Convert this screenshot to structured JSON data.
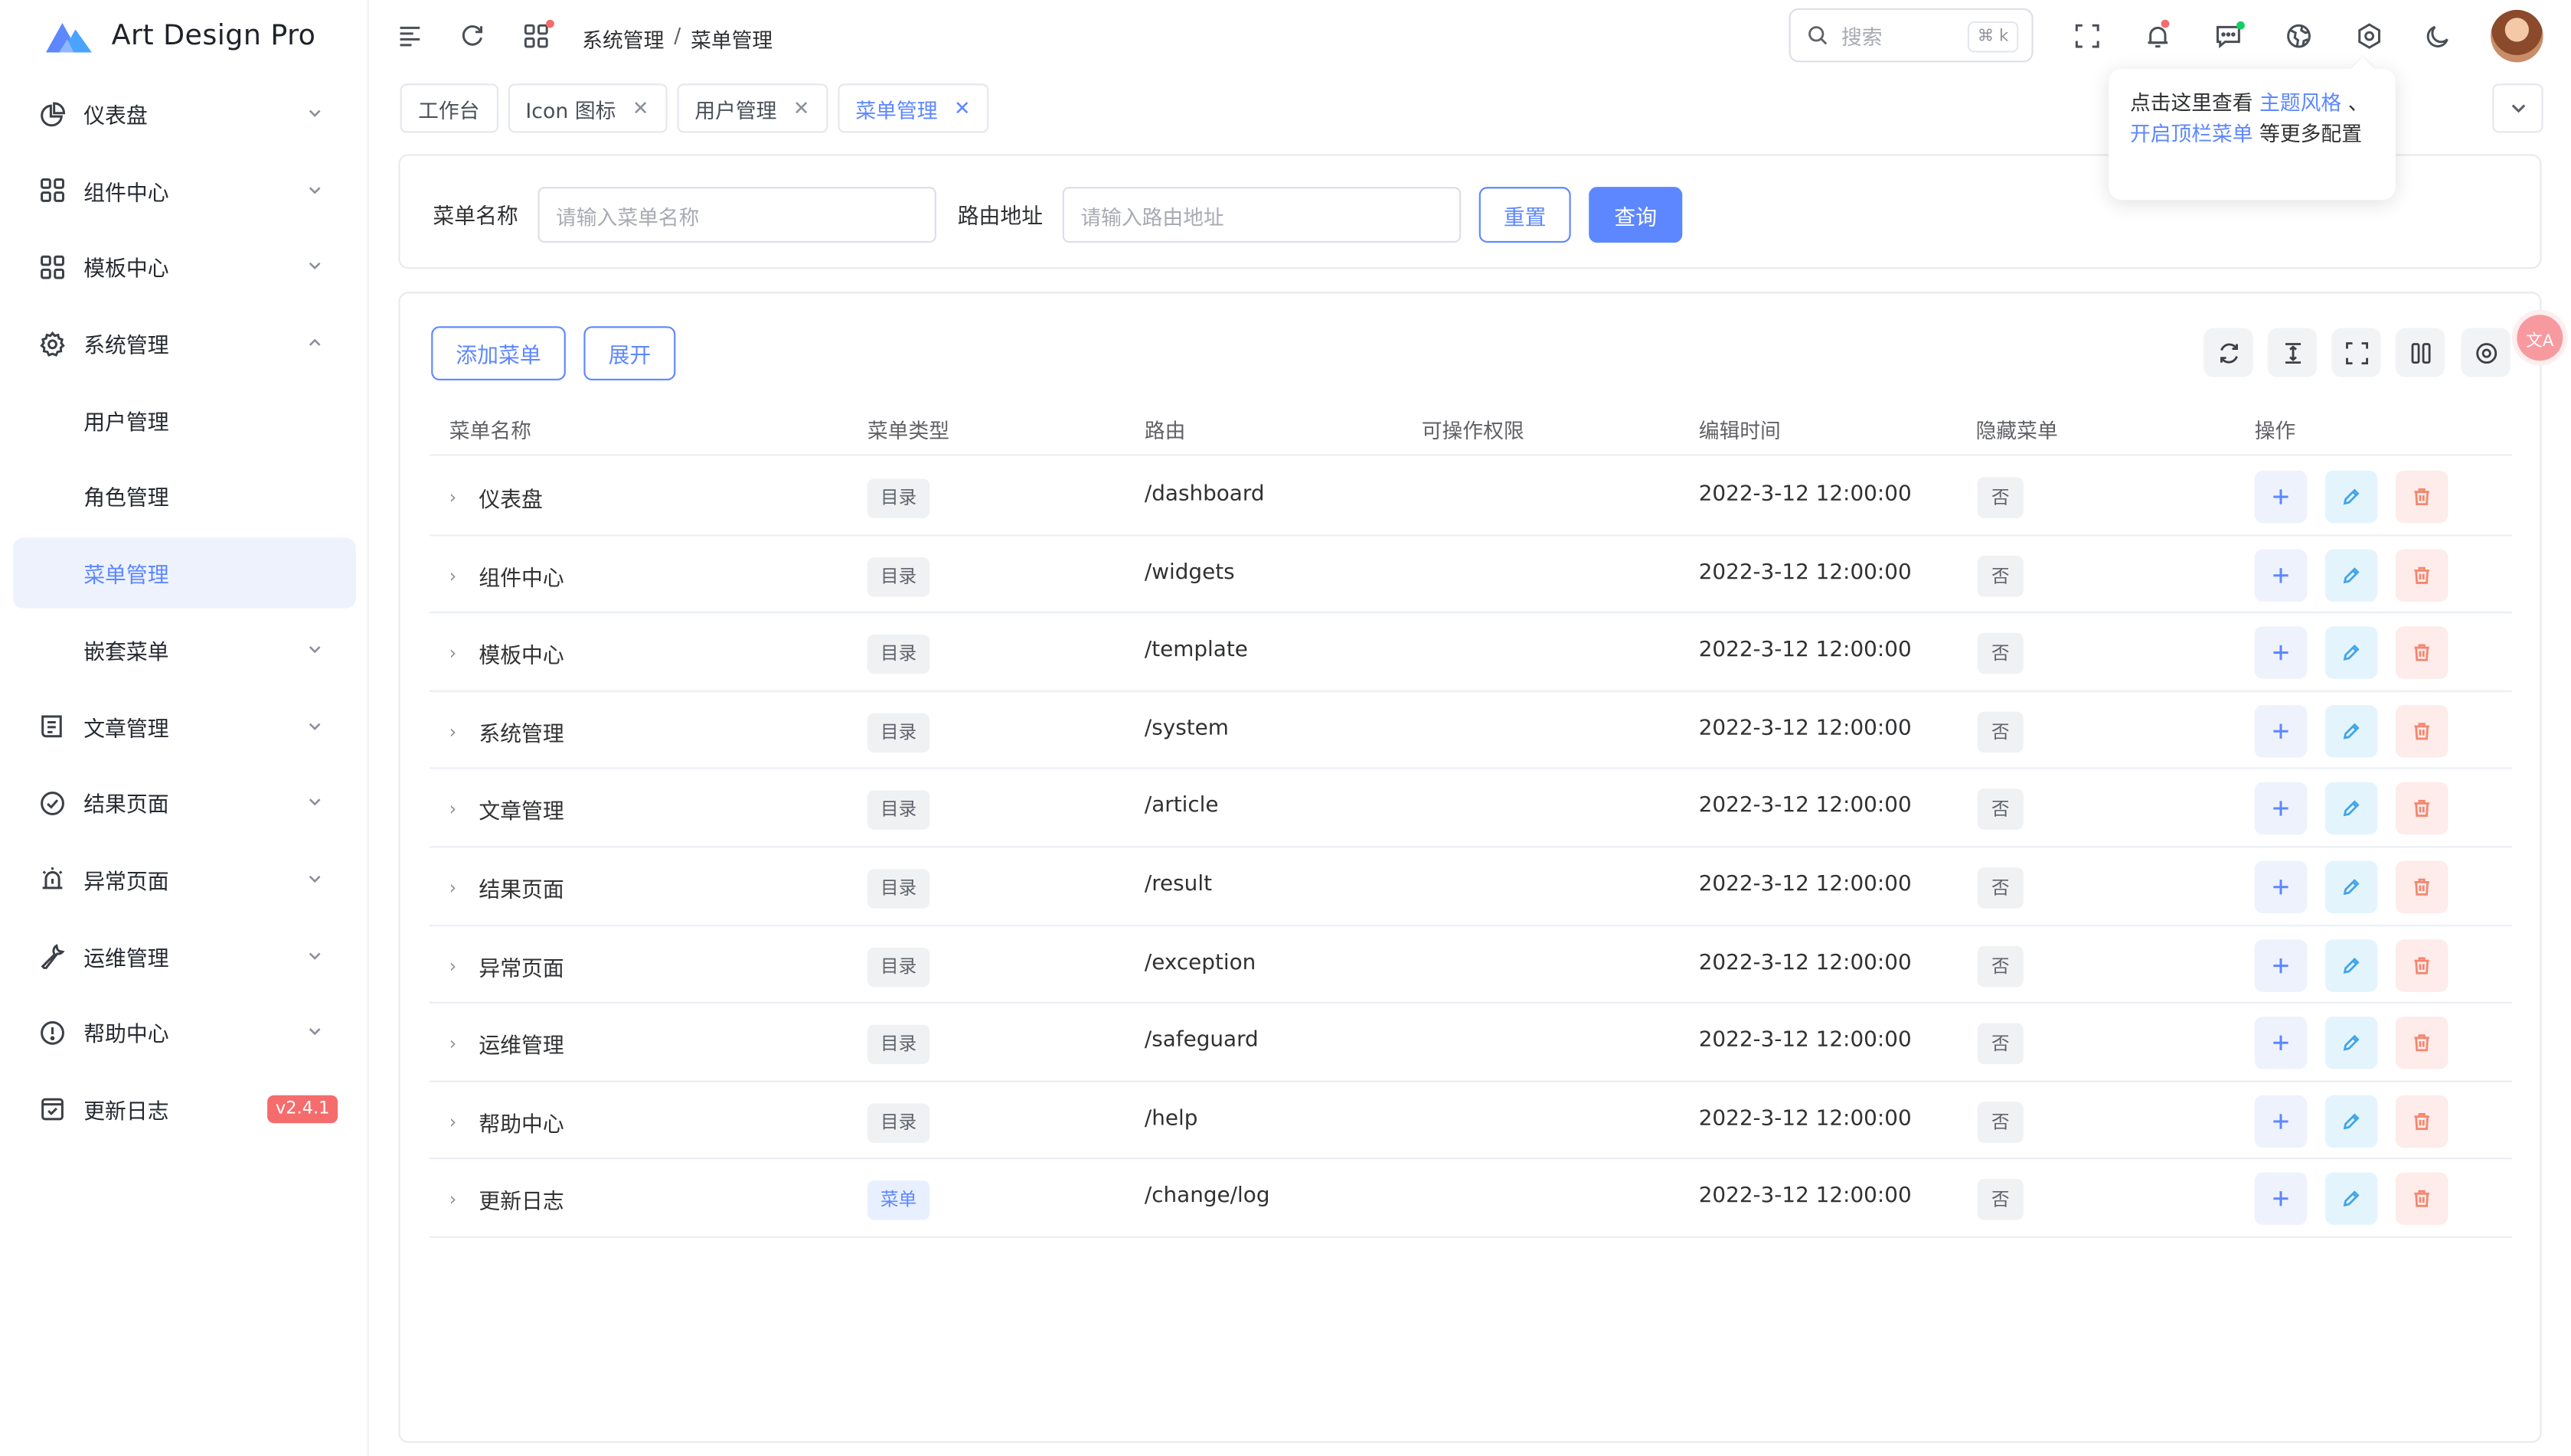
{
  "app": {
    "title": "Art Design Pro"
  },
  "colors": {
    "primary": "#5d87ff",
    "danger": "#f56c6c",
    "active_bg": "#eef2fd"
  },
  "sidebar": {
    "items": [
      {
        "label": "仪表盘",
        "icon": "pie-chart-icon",
        "chevron": "down"
      },
      {
        "label": "组件中心",
        "icon": "grid-icon",
        "chevron": "down"
      },
      {
        "label": "模板中心",
        "icon": "grid-icon",
        "chevron": "down"
      },
      {
        "label": "系统管理",
        "icon": "gear-icon",
        "chevron": "up"
      },
      {
        "label": "用户管理",
        "sub": true
      },
      {
        "label": "角色管理",
        "sub": true
      },
      {
        "label": "菜单管理",
        "sub": true,
        "active": true
      },
      {
        "label": "嵌套菜单",
        "sub": true,
        "chevron": "down"
      },
      {
        "label": "文章管理",
        "icon": "article-icon",
        "chevron": "down"
      },
      {
        "label": "结果页面",
        "icon": "check-circle-icon",
        "chevron": "down"
      },
      {
        "label": "异常页面",
        "icon": "alarm-icon",
        "chevron": "down"
      },
      {
        "label": "运维管理",
        "icon": "wrench-icon",
        "chevron": "down"
      },
      {
        "label": "帮助中心",
        "icon": "exclamation-circle-icon",
        "chevron": "down"
      },
      {
        "label": "更新日志",
        "icon": "calendar-check-icon",
        "badge": "v2.4.1"
      }
    ]
  },
  "header": {
    "breadcrumb": [
      "系统管理",
      "菜单管理"
    ],
    "breadcrumb_sep": "/",
    "search_placeholder": "搜索",
    "search_shortcut": "⌘ k"
  },
  "tabs": [
    {
      "label": "工作台",
      "closable": false
    },
    {
      "label": "Icon 图标",
      "closable": true
    },
    {
      "label": "用户管理",
      "closable": true
    },
    {
      "label": "菜单管理",
      "closable": true,
      "active": true
    }
  ],
  "tooltip": {
    "prefix": "点击这里查看",
    "link1": "主题风格",
    "mid": "、",
    "link2": "开启顶栏菜单",
    "suffix": "等更多配置"
  },
  "search_form": {
    "menu_name_label": "菜单名称",
    "menu_name_placeholder": "请输入菜单名称",
    "route_label": "路由地址",
    "route_placeholder": "请输入路由地址",
    "reset_label": "重置",
    "query_label": "查询"
  },
  "table_toolbar": {
    "add_label": "添加菜单",
    "expand_label": "展开"
  },
  "table": {
    "columns": [
      "菜单名称",
      "菜单类型",
      "路由",
      "可操作权限",
      "编辑时间",
      "隐藏菜单",
      "操作"
    ],
    "rows": [
      {
        "name": "仪表盘",
        "type": "目录",
        "path": "/dashboard",
        "perm": "",
        "time": "2022-3-12 12:00:00",
        "hidden": "否"
      },
      {
        "name": "组件中心",
        "type": "目录",
        "path": "/widgets",
        "perm": "",
        "time": "2022-3-12 12:00:00",
        "hidden": "否"
      },
      {
        "name": "模板中心",
        "type": "目录",
        "path": "/template",
        "perm": "",
        "time": "2022-3-12 12:00:00",
        "hidden": "否"
      },
      {
        "name": "系统管理",
        "type": "目录",
        "path": "/system",
        "perm": "",
        "time": "2022-3-12 12:00:00",
        "hidden": "否"
      },
      {
        "name": "文章管理",
        "type": "目录",
        "path": "/article",
        "perm": "",
        "time": "2022-3-12 12:00:00",
        "hidden": "否"
      },
      {
        "name": "结果页面",
        "type": "目录",
        "path": "/result",
        "perm": "",
        "time": "2022-3-12 12:00:00",
        "hidden": "否"
      },
      {
        "name": "异常页面",
        "type": "目录",
        "path": "/exception",
        "perm": "",
        "time": "2022-3-12 12:00:00",
        "hidden": "否"
      },
      {
        "name": "运维管理",
        "type": "目录",
        "path": "/safeguard",
        "perm": "",
        "time": "2022-3-12 12:00:00",
        "hidden": "否"
      },
      {
        "name": "帮助中心",
        "type": "目录",
        "path": "/help",
        "perm": "",
        "time": "2022-3-12 12:00:00",
        "hidden": "否"
      },
      {
        "name": "更新日志",
        "type": "菜单",
        "path": "/change/log",
        "perm": "",
        "time": "2022-3-12 12:00:00",
        "hidden": "否"
      }
    ]
  }
}
